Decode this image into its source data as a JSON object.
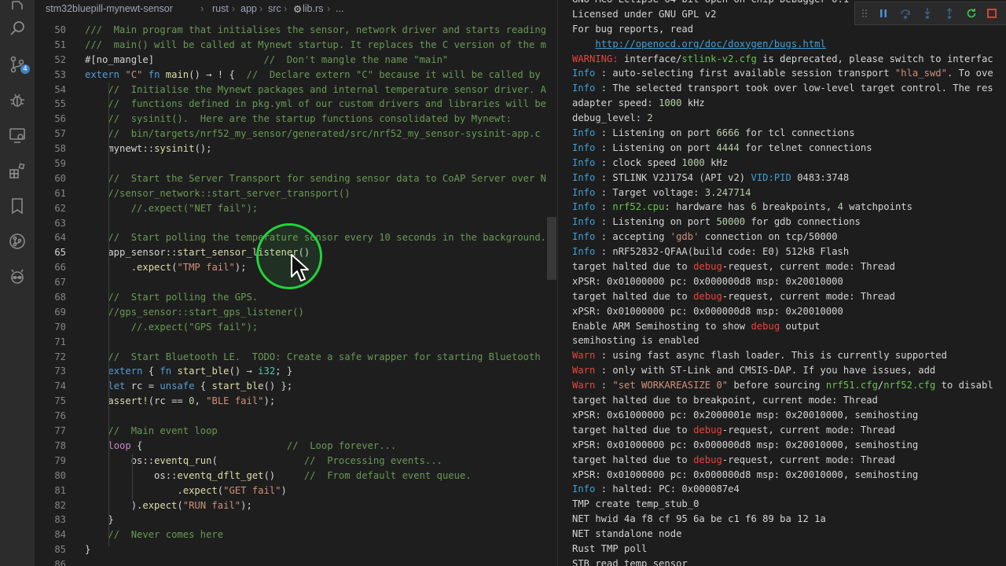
{
  "breadcrumb": {
    "items": [
      "stm32bluepill-mynewt-sensor",
      "rust",
      "app",
      "src",
      "lib.rs",
      "..."
    ],
    "separator": "›"
  },
  "activity_bar": {
    "icons": [
      "files-icon",
      "search-icon",
      "source-control-icon",
      "debug-icon",
      "remote-explorer-icon",
      "extensions-icon",
      "bookmark-icon",
      "git-graph-icon",
      "alien-icon"
    ],
    "scm_badge": "4"
  },
  "editor": {
    "current_line": "65",
    "lines": [
      {
        "n": "50",
        "h": "<span class=\"c\">///  Main program that initialises the sensor, network driver and starts reading</span>"
      },
      {
        "n": "51",
        "h": "<span class=\"c\">///  main() will be called at Mynewt startup. It replaces the C version of the m</span>"
      },
      {
        "n": "52",
        "h": "#[no_mangle]                   <span class=\"c\">//  Don't mangle the name \"main\"</span>"
      },
      {
        "n": "53",
        "h": "<span class=\"k\">extern</span> <span class=\"s\">\"C\"</span> <span class=\"k\">fn</span> <span class=\"f\">main</span>() → ! {  <span class=\"c\">//  Declare extern \"C\" because it will be called by</span>"
      },
      {
        "n": "54",
        "h": "    <span class=\"c\">//  Initialise the Mynewt packages and internal temperature sensor driver. A</span>"
      },
      {
        "n": "55",
        "h": "    <span class=\"c\">//  functions defined in pkg.yml of our custom drivers and libraries will be</span>"
      },
      {
        "n": "56",
        "h": "    <span class=\"c\">//  sysinit().  Here are the startup functions consolidated by Mynewt:</span>"
      },
      {
        "n": "57",
        "h": "    <span class=\"c\">//  bin/targets/nrf52_my_sensor/generated/src/nrf52_my_sensor-sysinit-app.c</span>"
      },
      {
        "n": "58",
        "h": "    mynewt::<span class=\"f\">sysinit</span>();"
      },
      {
        "n": "59",
        "h": ""
      },
      {
        "n": "60",
        "h": "    <span class=\"c\">//  Start the Server Transport for sending sensor data to CoAP Server over N</span>"
      },
      {
        "n": "61",
        "h": "    <span class=\"c\">//sensor_network::start_server_transport()</span>"
      },
      {
        "n": "62",
        "h": "        <span class=\"c\">//.expect(\"NET fail\");</span>"
      },
      {
        "n": "63",
        "h": ""
      },
      {
        "n": "64",
        "h": "    <span class=\"c\">//  Start polling the temperature sensor every 10 seconds in the background.</span>"
      },
      {
        "n": "65",
        "h": "    app_sensor::<span class=\"f\">start_sensor_listener</span>()"
      },
      {
        "n": "66",
        "h": "        .<span class=\"f\">expect</span>(<span class=\"s\">\"TMP fail\"</span>);"
      },
      {
        "n": "67",
        "h": ""
      },
      {
        "n": "68",
        "h": "    <span class=\"c\">//  Start polling the GPS.</span>"
      },
      {
        "n": "69",
        "h": "    <span class=\"c\">//gps_sensor::start_gps_listener()</span>"
      },
      {
        "n": "70",
        "h": "        <span class=\"c\">//.expect(\"GPS fail\");</span>"
      },
      {
        "n": "71",
        "h": ""
      },
      {
        "n": "72",
        "h": "    <span class=\"c\">//  Start Bluetooth LE.  TODO: Create a safe wrapper for starting Bluetooth</span>"
      },
      {
        "n": "73",
        "h": "    <span class=\"k\">extern</span> { <span class=\"k\">fn</span> <span class=\"f\">start_ble</span>() → <span class=\"t\">i32</span>; }"
      },
      {
        "n": "74",
        "h": "    <span class=\"k\">let</span> rc = <span class=\"k\">unsafe</span> { <span class=\"f\">start_ble</span>() };"
      },
      {
        "n": "75",
        "h": "    <span class=\"f\">assert!</span>(rc == <span class=\"n\">0</span>, <span class=\"s\">\"BLE fail\"</span>);"
      },
      {
        "n": "76",
        "h": ""
      },
      {
        "n": "77",
        "h": "    <span class=\"c\">//  Main event loop</span>"
      },
      {
        "n": "78",
        "h": "    <span class=\"k2\">loop</span> {                         <span class=\"c\">//  Loop forever...</span>"
      },
      {
        "n": "79",
        "h": "        os::<span class=\"f\">eventq_run</span>(               <span class=\"c\">//  Processing events...</span>"
      },
      {
        "n": "80",
        "h": "            os::<span class=\"f\">eventq_dflt_get</span>()     <span class=\"c\">//  From default event queue.</span>"
      },
      {
        "n": "81",
        "h": "                .<span class=\"f\">expect</span>(<span class=\"s\">\"GET fail\"</span>)"
      },
      {
        "n": "82",
        "h": "        ).<span class=\"f\">expect</span>(<span class=\"s\">\"RUN fail\"</span>);"
      },
      {
        "n": "83",
        "h": "    }"
      },
      {
        "n": "84",
        "h": "    <span class=\"c\">//  Never comes here</span>"
      },
      {
        "n": "85",
        "h": "}"
      },
      {
        "n": "86",
        "h": ""
      }
    ]
  },
  "terminal": {
    "lines": [
      "GNU MCU Eclipse 64-bit Open On-Chip Debugger 0.1",
      "Licensed under GNU GPL v2",
      "For bug reports, read",
      "    <span class=\"link\">http://openocd.org/doc/doxygen/bugs.html</span>",
      "<span class=\"warn\">WARNING:</span> interface/<span class=\"hl\">stlink-v2.cfg</span> is deprecated, please switch to interfac",
      "<span class=\"info\">Info</span> : auto-selecting first available session transport <span class=\"s\">\"hla_swd\"</span>. To ove",
      "<span class=\"info\">Info</span> : The selected transport took over low-level target control. The res",
      "adapter speed: <span class=\"num\">1000</span> kHz",
      "debug_level: <span class=\"num\">2</span>",
      "<span class=\"info\">Info</span> : Listening on port <span class=\"num\">6666</span> for tcl connections",
      "<span class=\"info\">Info</span> : Listening on port <span class=\"num\">4444</span> for telnet connections",
      "<span class=\"info\">Info</span> : clock speed <span class=\"num\">1000</span> kHz",
      "<span class=\"info\">Info</span> : STLINK V2J17S4 (API v2) <span class=\"vid\">VID:PID</span> 0483:3748",
      "<span class=\"info\">Info</span> : Target voltage: <span class=\"num\">3.247714</span>",
      "<span class=\"info\">Info</span> : <span class=\"hl\">nrf52.cpu</span>: hardware has <span class=\"num\">6</span> breakpoints, <span class=\"num\">4</span> watchpoints",
      "<span class=\"info\">Info</span> : Listening on port <span class=\"num\">50000</span> for gdb connections",
      "<span class=\"info\">Info</span> : accepting <span class=\"s\">'gdb'</span> connection on tcp/50000",
      "<span class=\"info\">Info</span> : nRF52832-QFAA(build code: E0) 512kB Flash",
      "target halted due to <span class=\"dbg\">debug</span>-request, current mode: Thread",
      "xPSR: 0x01000000 pc: 0x000000d8 msp: 0x20010000",
      "target halted due to <span class=\"dbg\">debug</span>-request, current mode: Thread",
      "xPSR: 0x01000000 pc: 0x000000d8 msp: 0x20010000",
      "Enable ARM Semihosting to show <span class=\"dbg\">debug</span> output",
      "semihosting is enabled",
      "<span class=\"warn\">Warn</span> : using fast async flash loader. This is currently supported",
      "<span class=\"warn\">Warn</span> : only with ST-Link and CMSIS-DAP. If you have issues, add",
      "<span class=\"warn\">Warn</span> : <span class=\"s\">\"set WORKAREASIZE 0\"</span> before sourcing <span class=\"hl\">nrf51.cfg</span>/<span class=\"hl\">nrf52.cfg</span> to disabl",
      "target halted due to breakpoint, current mode: Thread",
      "xPSR: 0x61000000 pc: 0x2000001e msp: 0x20010000, semihosting",
      "target halted due to <span class=\"dbg\">debug</span>-request, current mode: Thread",
      "xPSR: 0x01000000 pc: 0x000000d8 msp: 0x20010000, semihosting",
      "target halted due to <span class=\"dbg\">debug</span>-request, current mode: Thread",
      "xPSR: 0x01000000 pc: 0x000000d8 msp: 0x20010000, semihosting",
      "<span class=\"info\">Info</span> : halted: PC: 0x000087e4",
      "TMP create temp_stub_0",
      "NET hwid 4a f8 cf 95 6a be c1 f6 89 ba 12 1a",
      "NET standalone node",
      "Rust TMP poll",
      "STB read temp sensor"
    ]
  },
  "debug_toolbar": {
    "buttons": [
      "drag-handle-icon",
      "pause-icon",
      "step-over-icon",
      "step-into-icon",
      "step-out-icon",
      "restart-icon",
      "stop-icon"
    ]
  }
}
